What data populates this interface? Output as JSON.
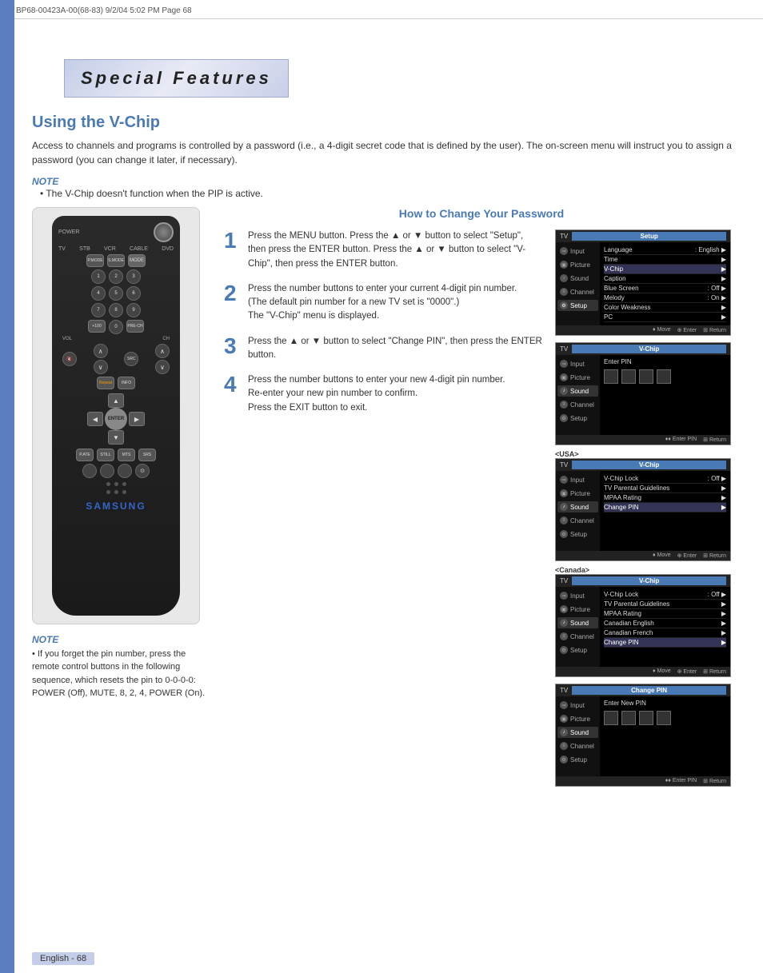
{
  "page": {
    "header_text": "BP68-00423A-00(68-83)   9/2/04   5:02 PM   Page 68",
    "footer_text": "English - 68"
  },
  "title": {
    "banner": "Special Features"
  },
  "section": {
    "title": "Using the V-Chip",
    "intro": "Access to channels and programs is controlled by a password (i.e., a 4-digit secret code that is defined by the user). The on-screen menu will instruct you to assign a password (you can change it later, if necessary).",
    "note_label": "NOTE",
    "note_text": "• The V-Chip doesn't function when the PIP is active.",
    "howto_title": "How to Change Your Password"
  },
  "steps": [
    {
      "number": "1",
      "text": "Press the MENU button. Press the ▲ or ▼ button to select \"Setup\", then press the ENTER button. Press the ▲ or ▼ button to select \"V-Chip\", then press the ENTER button."
    },
    {
      "number": "2",
      "text": "Press the number buttons to enter your current 4-digit pin number.\n(The default pin number for a new TV set is \"0000\".)\nThe \"V-Chip\" menu is displayed."
    },
    {
      "number": "3",
      "text": "Press the ▲ or ▼ button to select \"Change PIN\", then press the ENTER button."
    },
    {
      "number": "4",
      "text": "Press the number buttons to enter your new 4-digit pin number.\nRe-enter your new pin number to confirm.\nPress the EXIT button to exit."
    }
  ],
  "screens": {
    "screen1": {
      "header": "Setup",
      "label": "TV",
      "items": [
        "Input",
        "Picture",
        "Sound",
        "Channel",
        "Setup"
      ],
      "active_item": "Setup",
      "content_rows": [
        {
          "label": "Language",
          "value": ": English"
        },
        {
          "label": "Time",
          "value": ""
        },
        {
          "label": "V-Chip",
          "value": "",
          "highlighted": true
        },
        {
          "label": "Caption",
          "value": ""
        },
        {
          "label": "Blue Screen",
          "value": ": Off"
        },
        {
          "label": "Melody",
          "value": ": On"
        },
        {
          "label": "Color Weakness",
          "value": ""
        },
        {
          "label": "PC",
          "value": ""
        }
      ],
      "footer": [
        "♦ Move",
        "⊕ Enter",
        "⊞ Return"
      ]
    },
    "screen2": {
      "header": "V-Chip",
      "label": "TV",
      "items": [
        "Input",
        "Picture",
        "Sound",
        "Channel",
        "Setup"
      ],
      "active_item": "Sound",
      "content_text": "Enter PIN",
      "footer": [
        "♦♦ Enter PIN",
        "⊞ Return"
      ]
    },
    "screen3_label": "<USA>",
    "screen3": {
      "header": "V-Chip",
      "label": "TV",
      "items": [
        "Input",
        "Picture",
        "Sound",
        "Channel",
        "Setup"
      ],
      "active_item": "Sound",
      "content_rows": [
        {
          "label": "V-Chip Lock",
          "value": ": Off"
        },
        {
          "label": "TV Parental Guidelines",
          "value": ""
        },
        {
          "label": "MPAA Rating",
          "value": ""
        },
        {
          "label": "Change PIN",
          "value": "",
          "highlighted": true
        }
      ],
      "footer": [
        "♦ Move",
        "⊕ Enter",
        "⊞ Return"
      ]
    },
    "screen4_label": "<Canada>",
    "screen4": {
      "header": "V-Chip",
      "label": "TV",
      "items": [
        "Input",
        "Picture",
        "Sound",
        "Channel",
        "Setup"
      ],
      "active_item": "Sound",
      "content_rows": [
        {
          "label": "V-Chip Lock",
          "value": ": Off"
        },
        {
          "label": "TV Parental Guidelines",
          "value": ""
        },
        {
          "label": "MPAA Rating",
          "value": ""
        },
        {
          "label": "Canadian English",
          "value": ""
        },
        {
          "label": "Canadian French",
          "value": ""
        },
        {
          "label": "Change PIN",
          "value": "",
          "highlighted": true
        }
      ],
      "footer": [
        "♦ Move",
        "⊕ Enter",
        "⊞ Return"
      ]
    },
    "screen5": {
      "header": "Change PIN",
      "label": "TV",
      "items": [
        "Input",
        "Picture",
        "Sound",
        "Channel",
        "Setup"
      ],
      "active_item": "Sound",
      "content_text": "Enter New PIN",
      "footer": [
        "♦♦ Enter PIN",
        "⊞ Return"
      ]
    }
  },
  "bottom_note": {
    "label": "NOTE",
    "items": [
      "If you forget the pin number, press the remote control buttons in the following sequence, which resets the pin to 0-0-0-0: POWER (Off), MUTE, 8, 2, 4, POWER (On)."
    ]
  },
  "remote": {
    "brand": "SAMSUNG"
  }
}
